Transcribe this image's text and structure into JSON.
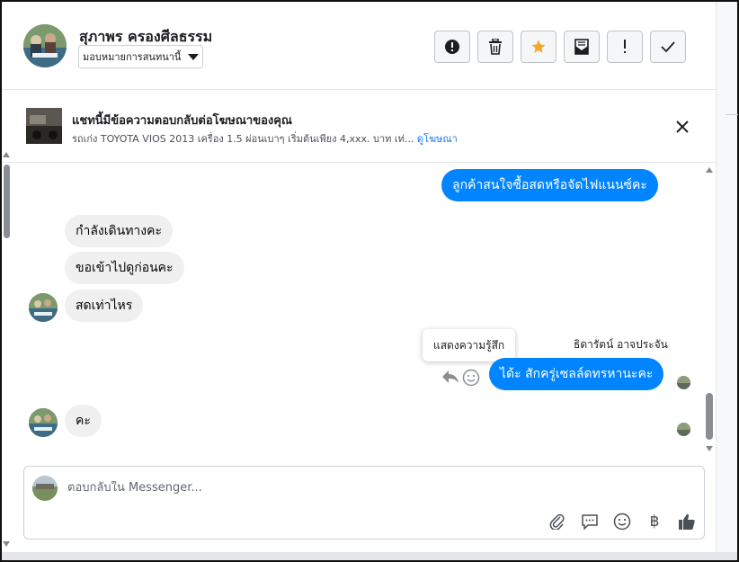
{
  "header": {
    "contact_name": "สุภาพร ครองศีลธรรม",
    "assign_label": "มอบหมายการสนทนานี้",
    "actions": [
      {
        "name": "spam-button",
        "icon": "alert-circle-icon"
      },
      {
        "name": "delete-button",
        "icon": "trash-icon"
      },
      {
        "name": "star-button",
        "icon": "star-icon"
      },
      {
        "name": "mark-unread-button",
        "icon": "envelope-icon"
      },
      {
        "name": "follow-up-button",
        "icon": "exclamation-icon"
      },
      {
        "name": "done-button",
        "icon": "check-icon"
      }
    ]
  },
  "ad": {
    "title": "แชทนี้มีข้อความตอบกลับต่อโฆษณาของคุณ",
    "description": "รถเก่ง TOYOTA VIOS 2013 เครื่อง 1.5 ผ่อนเบาๆ เริ่มต้นเพียง 4,xxx. บาท เท่...",
    "link_label": "ดูโฆษณา"
  },
  "messages": {
    "out_1": "ลูกค้าสนใจซื้อสดหรือจัดไฟแนนซ์คะ",
    "in_1": "กำลังเดินทางคะ",
    "in_2": "ขอเข้าไปดูก่อนคะ",
    "in_3": "สดเท่าไหร",
    "sender_name": "ธิดารัตน์ อาจประจัน",
    "out_2": "ได้ะ สักครู่เซลล์ดทรหาน​ะคะ",
    "tooltip": "แสดงความรู้สึก",
    "in_4": "คะ"
  },
  "composer": {
    "placeholder": "ตอบกลับใน Messenger...",
    "tools": [
      "attachment-icon",
      "saved-reply-icon",
      "emoji-icon",
      "baht-icon",
      "thumbs-up-icon"
    ],
    "baht_symbol": "฿"
  },
  "colors": {
    "accent": "#0084ff",
    "star": "#f5a623",
    "incoming_bubble": "#f0f0f0"
  }
}
